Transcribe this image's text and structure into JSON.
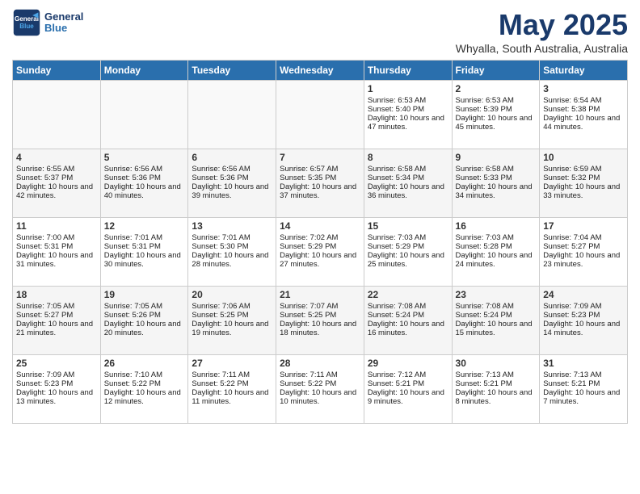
{
  "header": {
    "logo_line1": "General",
    "logo_line2": "Blue",
    "month": "May 2025",
    "location": "Whyalla, South Australia, Australia"
  },
  "weekdays": [
    "Sunday",
    "Monday",
    "Tuesday",
    "Wednesday",
    "Thursday",
    "Friday",
    "Saturday"
  ],
  "weeks": [
    [
      {
        "day": "",
        "info": ""
      },
      {
        "day": "",
        "info": ""
      },
      {
        "day": "",
        "info": ""
      },
      {
        "day": "",
        "info": ""
      },
      {
        "day": "1",
        "info": "Sunrise: 6:53 AM\nSunset: 5:40 PM\nDaylight: 10 hours and 47 minutes."
      },
      {
        "day": "2",
        "info": "Sunrise: 6:53 AM\nSunset: 5:39 PM\nDaylight: 10 hours and 45 minutes."
      },
      {
        "day": "3",
        "info": "Sunrise: 6:54 AM\nSunset: 5:38 PM\nDaylight: 10 hours and 44 minutes."
      }
    ],
    [
      {
        "day": "4",
        "info": "Sunrise: 6:55 AM\nSunset: 5:37 PM\nDaylight: 10 hours and 42 minutes."
      },
      {
        "day": "5",
        "info": "Sunrise: 6:56 AM\nSunset: 5:36 PM\nDaylight: 10 hours and 40 minutes."
      },
      {
        "day": "6",
        "info": "Sunrise: 6:56 AM\nSunset: 5:36 PM\nDaylight: 10 hours and 39 minutes."
      },
      {
        "day": "7",
        "info": "Sunrise: 6:57 AM\nSunset: 5:35 PM\nDaylight: 10 hours and 37 minutes."
      },
      {
        "day": "8",
        "info": "Sunrise: 6:58 AM\nSunset: 5:34 PM\nDaylight: 10 hours and 36 minutes."
      },
      {
        "day": "9",
        "info": "Sunrise: 6:58 AM\nSunset: 5:33 PM\nDaylight: 10 hours and 34 minutes."
      },
      {
        "day": "10",
        "info": "Sunrise: 6:59 AM\nSunset: 5:32 PM\nDaylight: 10 hours and 33 minutes."
      }
    ],
    [
      {
        "day": "11",
        "info": "Sunrise: 7:00 AM\nSunset: 5:31 PM\nDaylight: 10 hours and 31 minutes."
      },
      {
        "day": "12",
        "info": "Sunrise: 7:01 AM\nSunset: 5:31 PM\nDaylight: 10 hours and 30 minutes."
      },
      {
        "day": "13",
        "info": "Sunrise: 7:01 AM\nSunset: 5:30 PM\nDaylight: 10 hours and 28 minutes."
      },
      {
        "day": "14",
        "info": "Sunrise: 7:02 AM\nSunset: 5:29 PM\nDaylight: 10 hours and 27 minutes."
      },
      {
        "day": "15",
        "info": "Sunrise: 7:03 AM\nSunset: 5:29 PM\nDaylight: 10 hours and 25 minutes."
      },
      {
        "day": "16",
        "info": "Sunrise: 7:03 AM\nSunset: 5:28 PM\nDaylight: 10 hours and 24 minutes."
      },
      {
        "day": "17",
        "info": "Sunrise: 7:04 AM\nSunset: 5:27 PM\nDaylight: 10 hours and 23 minutes."
      }
    ],
    [
      {
        "day": "18",
        "info": "Sunrise: 7:05 AM\nSunset: 5:27 PM\nDaylight: 10 hours and 21 minutes."
      },
      {
        "day": "19",
        "info": "Sunrise: 7:05 AM\nSunset: 5:26 PM\nDaylight: 10 hours and 20 minutes."
      },
      {
        "day": "20",
        "info": "Sunrise: 7:06 AM\nSunset: 5:25 PM\nDaylight: 10 hours and 19 minutes."
      },
      {
        "day": "21",
        "info": "Sunrise: 7:07 AM\nSunset: 5:25 PM\nDaylight: 10 hours and 18 minutes."
      },
      {
        "day": "22",
        "info": "Sunrise: 7:08 AM\nSunset: 5:24 PM\nDaylight: 10 hours and 16 minutes."
      },
      {
        "day": "23",
        "info": "Sunrise: 7:08 AM\nSunset: 5:24 PM\nDaylight: 10 hours and 15 minutes."
      },
      {
        "day": "24",
        "info": "Sunrise: 7:09 AM\nSunset: 5:23 PM\nDaylight: 10 hours and 14 minutes."
      }
    ],
    [
      {
        "day": "25",
        "info": "Sunrise: 7:09 AM\nSunset: 5:23 PM\nDaylight: 10 hours and 13 minutes."
      },
      {
        "day": "26",
        "info": "Sunrise: 7:10 AM\nSunset: 5:22 PM\nDaylight: 10 hours and 12 minutes."
      },
      {
        "day": "27",
        "info": "Sunrise: 7:11 AM\nSunset: 5:22 PM\nDaylight: 10 hours and 11 minutes."
      },
      {
        "day": "28",
        "info": "Sunrise: 7:11 AM\nSunset: 5:22 PM\nDaylight: 10 hours and 10 minutes."
      },
      {
        "day": "29",
        "info": "Sunrise: 7:12 AM\nSunset: 5:21 PM\nDaylight: 10 hours and 9 minutes."
      },
      {
        "day": "30",
        "info": "Sunrise: 7:13 AM\nSunset: 5:21 PM\nDaylight: 10 hours and 8 minutes."
      },
      {
        "day": "31",
        "info": "Sunrise: 7:13 AM\nSunset: 5:21 PM\nDaylight: 10 hours and 7 minutes."
      }
    ]
  ]
}
